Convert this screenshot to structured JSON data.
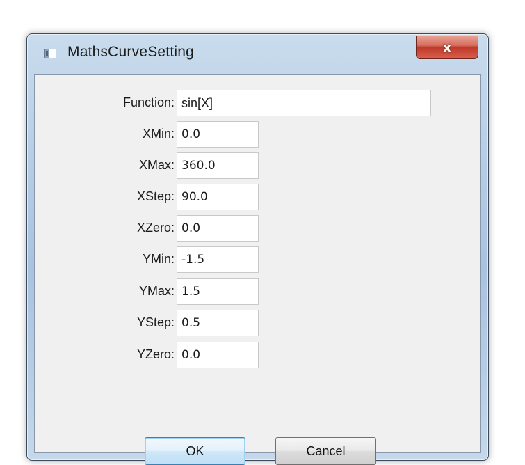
{
  "window": {
    "title": "MathsCurveSetting",
    "close_symbol": "x"
  },
  "form": {
    "fields": [
      {
        "label": "Function:",
        "value": "sin[X]"
      },
      {
        "label": "XMin:",
        "value": "0.0"
      },
      {
        "label": "XMax:",
        "value": "360.0"
      },
      {
        "label": "XStep:",
        "value": "90.0"
      },
      {
        "label": "XZero:",
        "value": "0.0"
      },
      {
        "label": "YMin:",
        "value": "-1.5"
      },
      {
        "label": "YMax:",
        "value": "1.5"
      },
      {
        "label": "YStep:",
        "value": "0.5"
      },
      {
        "label": "YZero:",
        "value": "0.0"
      }
    ]
  },
  "buttons": {
    "ok": "OK",
    "cancel": "Cancel"
  },
  "icons": {
    "app": "window-icon",
    "close": "close-icon"
  },
  "colors": {
    "frame": "#b6cde4",
    "close_button": "#c0392b",
    "default_button_border": "#3c7fb1",
    "client_background": "#f0f0f0"
  }
}
